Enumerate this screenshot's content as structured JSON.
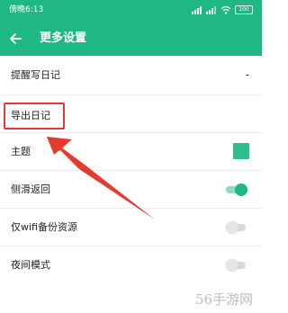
{
  "status_bar": {
    "time": "傍晚6:13",
    "battery": "100"
  },
  "app_bar": {
    "title": "更多设置"
  },
  "settings": {
    "items": [
      {
        "label": "提醒写日记",
        "value": "-"
      },
      {
        "label": "导出日记"
      },
      {
        "label": "主题",
        "swatch_color": "#2fbf8c"
      },
      {
        "label": "侧滑返回",
        "toggle_on": true
      },
      {
        "label": "仅wifi备份资源",
        "toggle_on": false
      },
      {
        "label": "夜间模式",
        "toggle_on": false
      }
    ]
  },
  "annotation": {
    "color": "#e53b2f"
  },
  "watermark": {
    "text": "56手游网"
  },
  "colors": {
    "brand": "#1fb884",
    "accent_toggle": "#1fb884"
  }
}
